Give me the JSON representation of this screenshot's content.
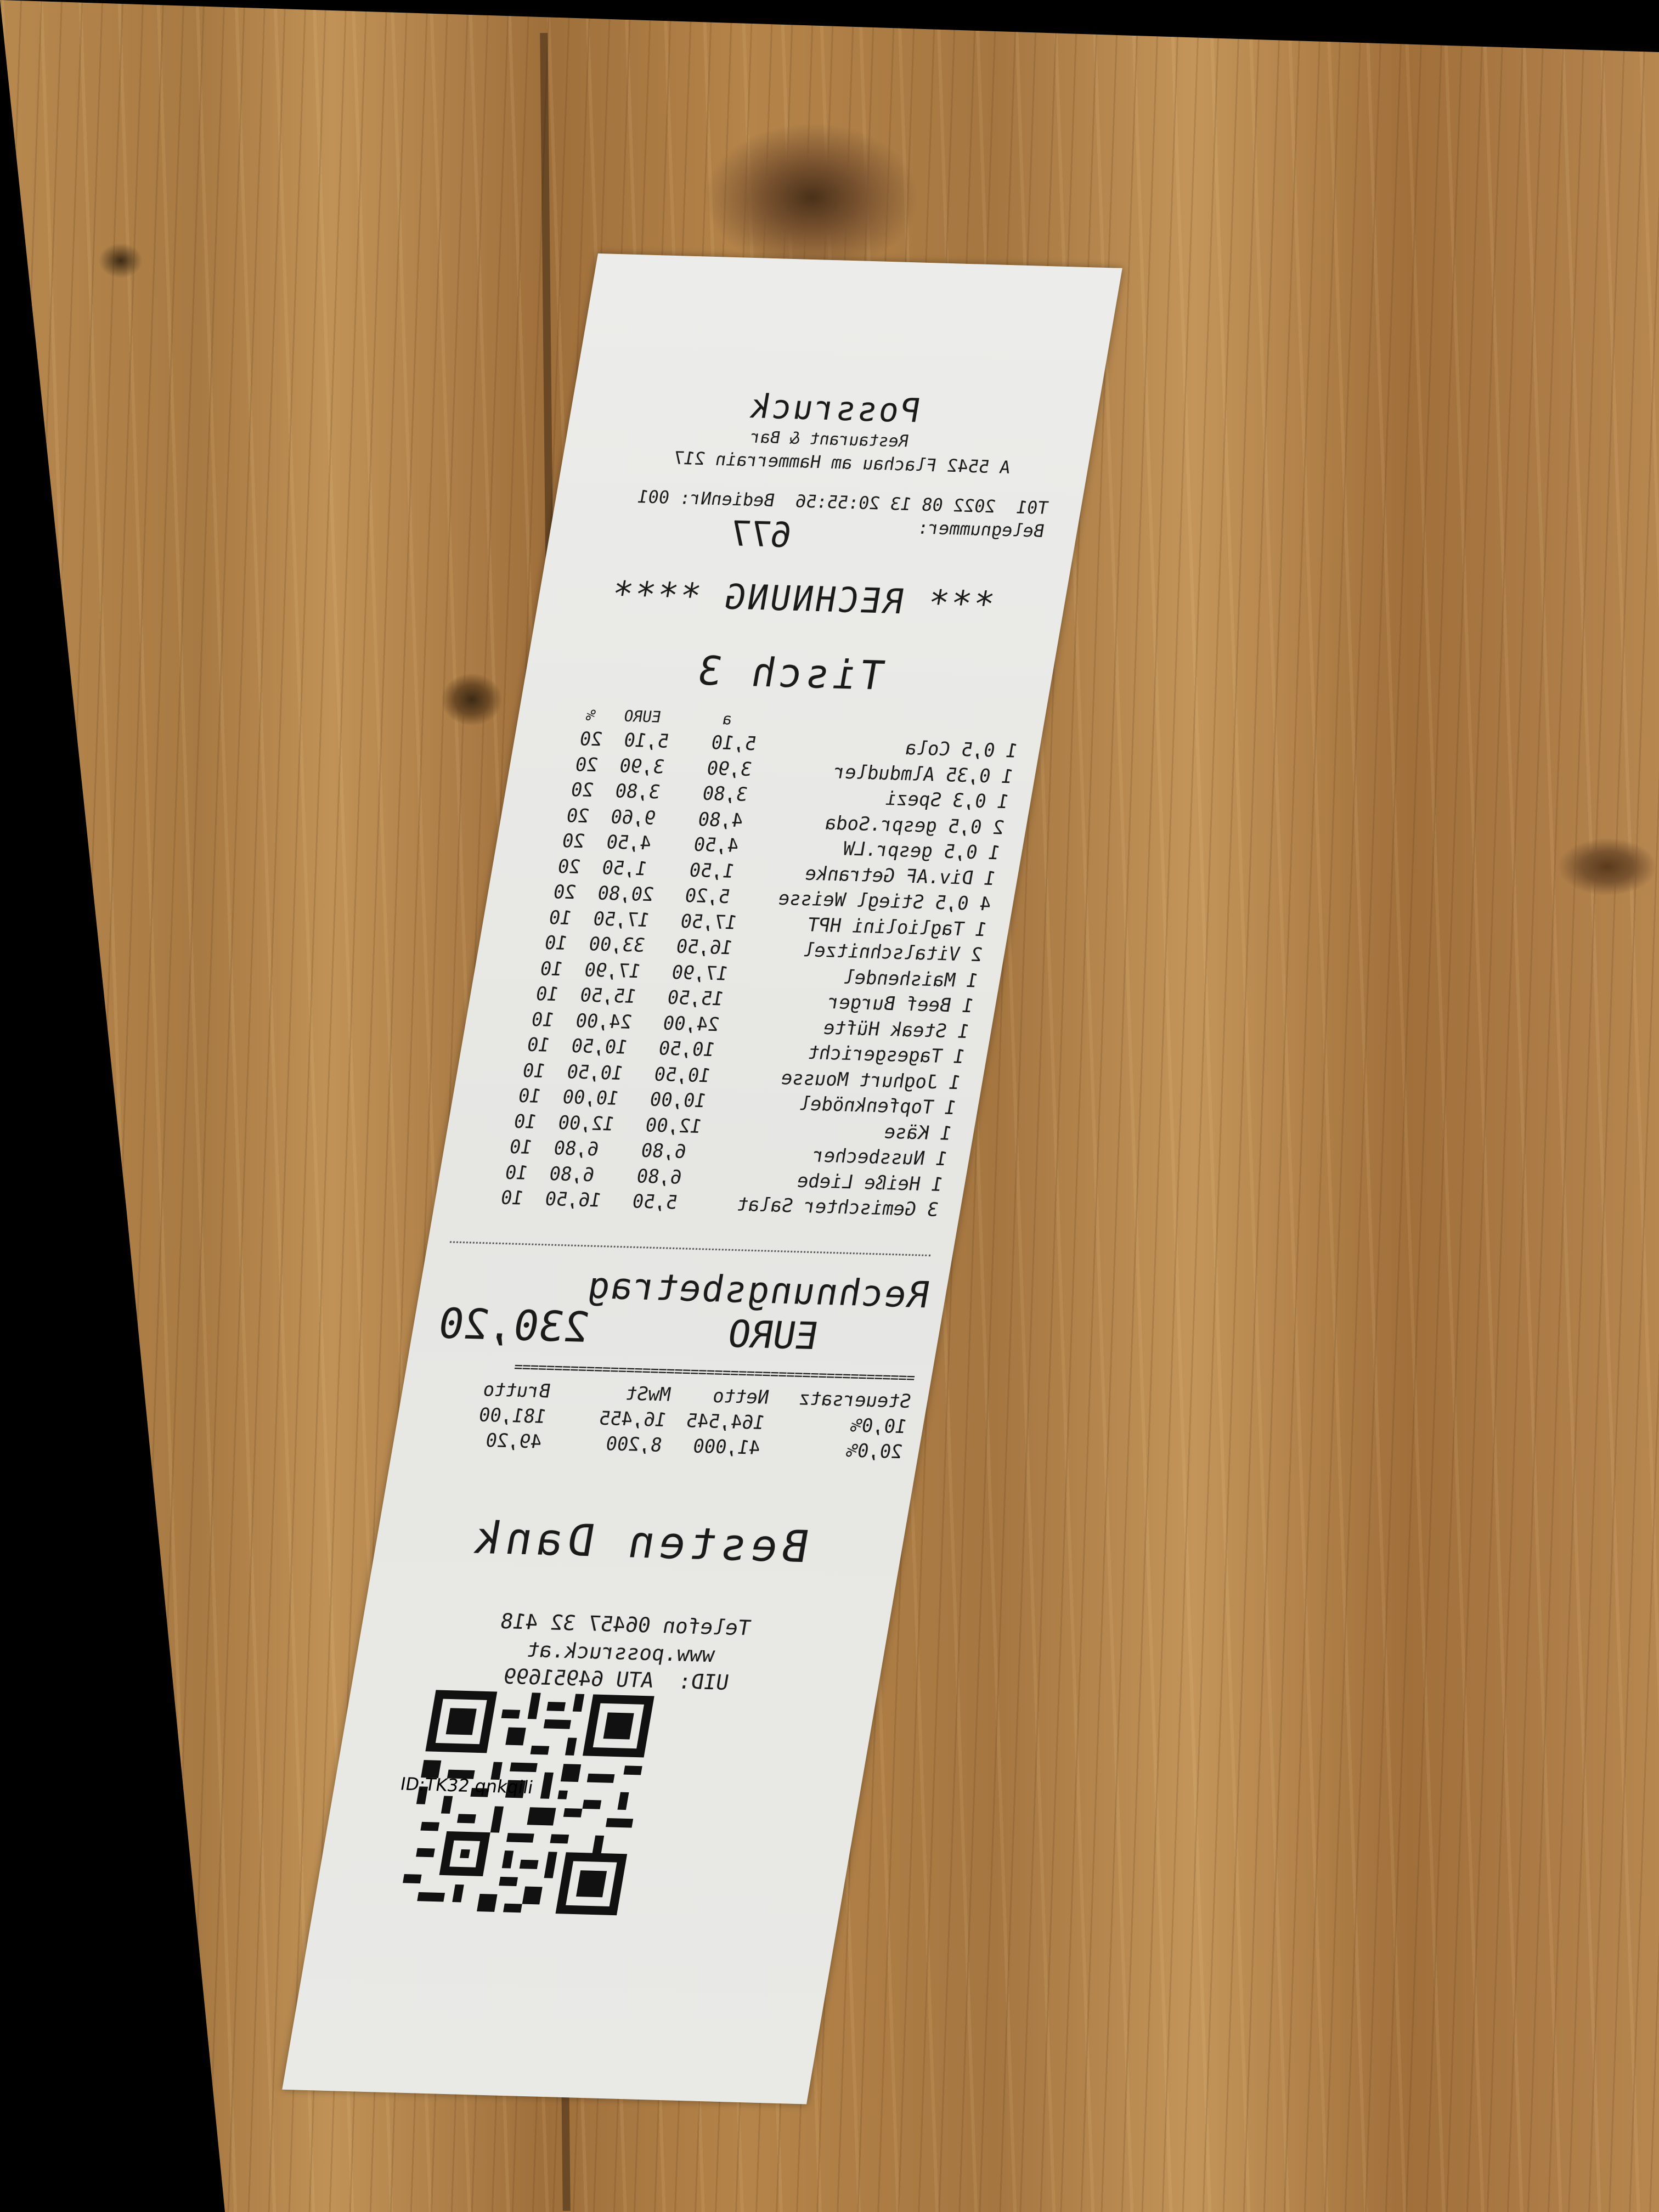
{
  "receipt": {
    "restaurant_name": "Possruck",
    "subtitle": "Restaurant & Bar",
    "address": "A 5542 Flachau   am Hammerrain 217",
    "datetime_line": "T01  2022 08 13 20:55:56  BedienNr: 001",
    "beleg_label": "Belegnummer:",
    "beleg_number": "677",
    "heading": "*** RECHNUNG ****",
    "table": "Tisch 3",
    "columns": {
      "price": "a",
      "euro": "EURO",
      "pct": "%"
    },
    "items": [
      {
        "qty_name": "1 0,5 Cola",
        "price": "5,10",
        "euro": "5,10",
        "pct": "20"
      },
      {
        "qty_name": "1 0,35 Almdudler",
        "price": "3,90",
        "euro": "3,90",
        "pct": "20"
      },
      {
        "qty_name": "1 0,3 Spezi",
        "price": "3,80",
        "euro": "3,80",
        "pct": "20"
      },
      {
        "qty_name": "2 0,5 gespr.Soda",
        "price": "4,80",
        "euro": "9,60",
        "pct": "20"
      },
      {
        "qty_name": "1 0,5 gespr.LW",
        "price": "4,50",
        "euro": "4,50",
        "pct": "20"
      },
      {
        "qty_name": "1 Div.AF Getranke",
        "price": "1,50",
        "euro": "1,50",
        "pct": "20"
      },
      {
        "qty_name": "4 0,5 Stiegl Weisse",
        "price": "5,20",
        "euro": "20,80",
        "pct": "20"
      },
      {
        "qty_name": "1 Tagliolini HPT",
        "price": "17,50",
        "euro": "17,50",
        "pct": "10"
      },
      {
        "qty_name": "2 Vitalschnitzel",
        "price": "16,50",
        "euro": "33,00",
        "pct": "10"
      },
      {
        "qty_name": "1 Maishendel",
        "price": "17,90",
        "euro": "17,90",
        "pct": "10"
      },
      {
        "qty_name": "1 Beef Burger",
        "price": "15,50",
        "euro": "15,50",
        "pct": "10"
      },
      {
        "qty_name": "1 Steak Hüfte",
        "price": "24,00",
        "euro": "24,00",
        "pct": "10"
      },
      {
        "qty_name": "1 Tagesgericht",
        "price": "10,50",
        "euro": "10,50",
        "pct": "10"
      },
      {
        "qty_name": "1 Joghurt Mousse",
        "price": "10,50",
        "euro": "10,50",
        "pct": "10"
      },
      {
        "qty_name": "1 Topfenknödel",
        "price": "10,00",
        "euro": "10,00",
        "pct": "10"
      },
      {
        "qty_name": "1 Käse",
        "price": "12,00",
        "euro": "12,00",
        "pct": "10"
      },
      {
        "qty_name": "1 Nussbecher",
        "price": "6,80",
        "euro": "6,80",
        "pct": "10"
      },
      {
        "qty_name": "1 Heiße Liebe",
        "price": "6,80",
        "euro": "6,80",
        "pct": "10"
      },
      {
        "qty_name": "3 Gemischter Salat",
        "price": "5,50",
        "euro": "16,50",
        "pct": "10"
      }
    ],
    "total_label": "Rechnungsbetrag",
    "total_currency": "EURO",
    "total_value": "230,20",
    "separator": "==================================================",
    "tax_headers": {
      "rate": "Steuersatz",
      "net": "Netto",
      "vat": "MwSt",
      "gross": "Brutto"
    },
    "tax_rows": [
      {
        "rate": "10,0%",
        "net": "164,545",
        "vat": "16,455",
        "gross": "181,00"
      },
      {
        "rate": "20,0%",
        "net": "41,000",
        "vat": "8,200",
        "gross": "49,20"
      }
    ],
    "thanks": "Besten Dank",
    "phone": "Telefon 06457 32 418",
    "website": "www.possruck.at",
    "uid": "UID:  ATU 64951699",
    "receipt_id": "ID:TK32 qnkqili"
  },
  "colors": {
    "paper": "#e8e8e5",
    "ink": "#1a1a1a",
    "wood": "#b08248"
  }
}
